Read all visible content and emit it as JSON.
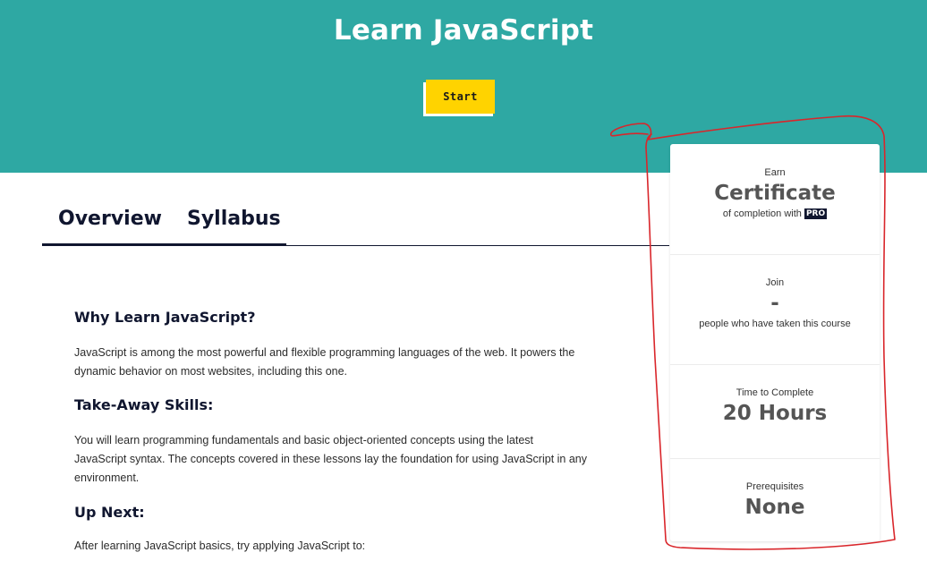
{
  "hero": {
    "title": "Learn JavaScript",
    "start_label": "Start",
    "bg_color": "#2ea8a3",
    "button_color": "#ffd300"
  },
  "tabs": [
    {
      "label": "Overview",
      "active": true
    },
    {
      "label": "Syllabus",
      "active": false
    }
  ],
  "content": {
    "sections": [
      {
        "heading": "Why Learn JavaScript?",
        "lines": [
          "JavaScript is among the most powerful and flexible programming languages of the web. It powers the",
          "dynamic behavior on most websites, including this one."
        ]
      },
      {
        "heading": "Take-Away Skills:",
        "lines": [
          "You will learn programming fundamentals and basic object-oriented concepts using the latest",
          "JavaScript syntax. The concepts covered in these lessons lay the foundation for using JavaScript in any",
          "environment."
        ]
      },
      {
        "heading": "Up Next:",
        "lines": [
          "After learning JavaScript basics, try applying JavaScript to:"
        ]
      }
    ]
  },
  "sidebar": {
    "stats": [
      {
        "label": "Earn",
        "value": "Certificate",
        "sub": "of completion with",
        "badge": "PRO"
      },
      {
        "label": "Join",
        "value": "-",
        "sub": "people who have taken this course"
      },
      {
        "label": "Time to Complete",
        "value": "20 Hours"
      },
      {
        "label": "Prerequisites",
        "value": "None"
      }
    ]
  },
  "annotation": {
    "color": "#d9262b"
  }
}
